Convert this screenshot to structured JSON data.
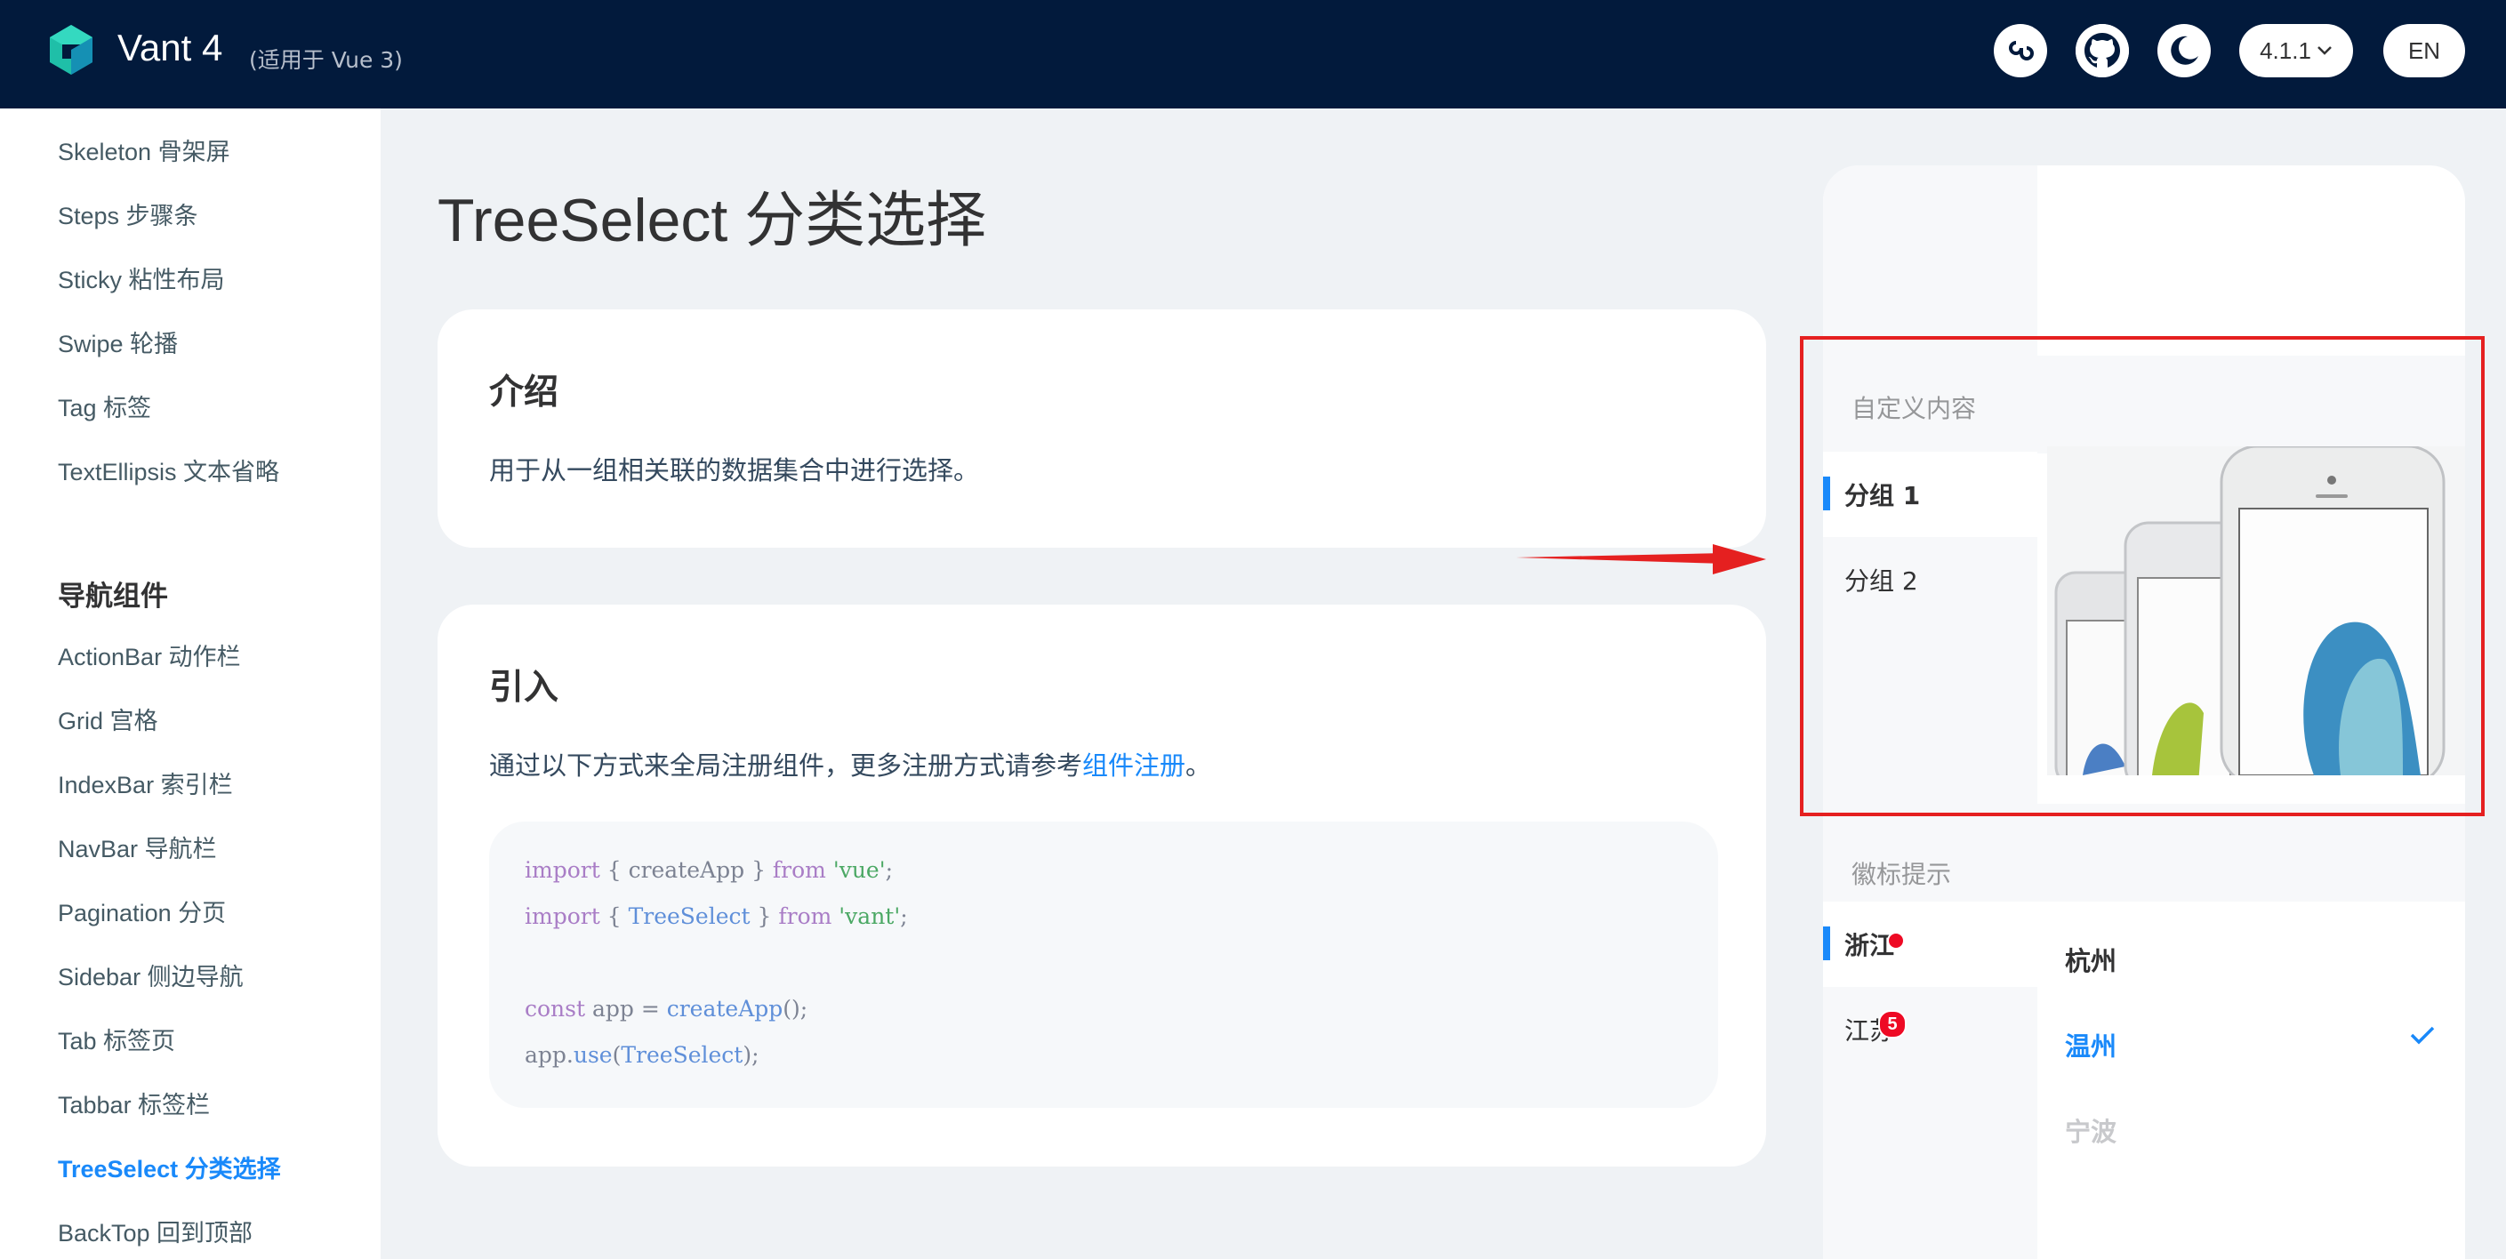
{
  "header": {
    "brand": "Vant 4",
    "brand_sub": "(适用于 Vue 3)",
    "version": "4.1.1",
    "lang": "EN"
  },
  "sidebar": {
    "items_top": [
      "Skeleton 骨架屏",
      "Steps 步骤条",
      "Sticky 粘性布局",
      "Swipe 轮播",
      "Tag 标签",
      "TextEllipsis 文本省略"
    ],
    "group_title": "导航组件",
    "items_nav": [
      "ActionBar 动作栏",
      "Grid 宫格",
      "IndexBar 索引栏",
      "NavBar 导航栏",
      "Pagination 分页",
      "Sidebar 侧边导航",
      "Tab 标签页",
      "Tabbar 标签栏",
      "TreeSelect 分类选择",
      "BackTop 回到顶部"
    ]
  },
  "main": {
    "title": "TreeSelect 分类选择",
    "intro": {
      "heading": "介绍",
      "text": "用于从一组相关联的数据集合中进行选择。"
    },
    "import": {
      "heading": "引入",
      "text": "通过以下方式来全局注册组件，更多注册方式请参考",
      "link": "组件注册",
      "text_end": "。",
      "code": {
        "l1_kw": "import",
        "l1_mid": " { createApp } ",
        "l1_from": "from",
        "l1_str": " 'vue'",
        "l1_end": ";",
        "l2_kw": "import",
        "l2_a": " { ",
        "l2_fn": "TreeSelect",
        "l2_b": " } ",
        "l2_from": "from",
        "l2_str": " 'vant'",
        "l2_end": ";",
        "l4_kw": "const",
        "l4_mid": " app = ",
        "l4_fn": "createApp",
        "l4_end": "();",
        "l5_a": "app.",
        "l5_fn": "use",
        "l5_b": "(",
        "l5_fn2": "TreeSelect",
        "l5_end": ");"
      }
    }
  },
  "preview": {
    "section_custom": "自定义内容",
    "groups": [
      "分组 1",
      "分组 2"
    ],
    "section_badge": "徽标提示",
    "provinces": [
      "浙江",
      "江苏"
    ],
    "province_badge": "5",
    "cities": [
      "杭州",
      "温州",
      "宁波"
    ]
  },
  "colors": {
    "header_bg": "#021a3c",
    "accent": "#1989fa",
    "badge_red": "#ee0a24",
    "annotation_red": "#e52020"
  }
}
